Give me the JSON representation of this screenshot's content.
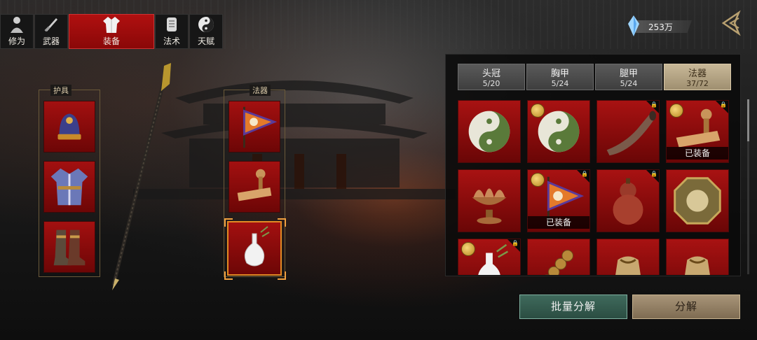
{
  "nav": {
    "tabs": [
      {
        "label": "修为",
        "icon": "meditation-icon"
      },
      {
        "label": "武器",
        "icon": "sword-icon"
      },
      {
        "label": "装备",
        "icon": "robe-icon",
        "active": true
      },
      {
        "label": "法术",
        "icon": "scroll-icon"
      },
      {
        "label": "天赋",
        "icon": "taiji-icon"
      }
    ]
  },
  "currency": {
    "amount": "253万",
    "icon": "crystal-icon"
  },
  "equipment": {
    "armor_group": {
      "title": "护具",
      "slots": [
        "head-hat",
        "chest-robe",
        "leg-boots"
      ]
    },
    "artifact_group": {
      "title": "法器",
      "slots": [
        "banner-flag",
        "wooden-seal",
        "white-vase"
      ],
      "selected_index": 2
    },
    "weapon": "spear"
  },
  "inventory": {
    "tabs": [
      {
        "label": "头冠",
        "count": "5/20"
      },
      {
        "label": "胸甲",
        "count": "5/24"
      },
      {
        "label": "腿甲",
        "count": "5/24"
      },
      {
        "label": "法器",
        "count": "37/72",
        "active": true
      }
    ],
    "items": [
      {
        "name": "taiji-disc",
        "badge": false,
        "locked": false,
        "equipped": ""
      },
      {
        "name": "taiji-disc",
        "badge": true,
        "locked": false,
        "equipped": ""
      },
      {
        "name": "horn",
        "badge": false,
        "locked": true,
        "equipped": ""
      },
      {
        "name": "wooden-seal",
        "badge": true,
        "locked": true,
        "equipped": "已装备"
      },
      {
        "name": "lotus-bowl",
        "badge": false,
        "locked": false,
        "equipped": ""
      },
      {
        "name": "banner-flag",
        "badge": true,
        "locked": true,
        "equipped": "已装备"
      },
      {
        "name": "gourd",
        "badge": false,
        "locked": true,
        "equipped": ""
      },
      {
        "name": "bagua-mirror",
        "badge": false,
        "locked": false,
        "equipped": ""
      },
      {
        "name": "white-vase",
        "badge": true,
        "locked": true,
        "equipped": ""
      },
      {
        "name": "coin-string",
        "badge": false,
        "locked": false,
        "equipped": ""
      },
      {
        "name": "treasure-bag",
        "badge": false,
        "locked": false,
        "equipped": ""
      },
      {
        "name": "treasure-bag",
        "badge": false,
        "locked": false,
        "equipped": ""
      }
    ]
  },
  "actions": {
    "batch_label": "批量分解",
    "decompose_label": "分解"
  },
  "colors": {
    "slot_red": "#a31010",
    "active_nav": "#b01010",
    "selected_border": "#e28a24",
    "batch_green": "#3f6a5c",
    "decompose_tan": "#a89478"
  }
}
